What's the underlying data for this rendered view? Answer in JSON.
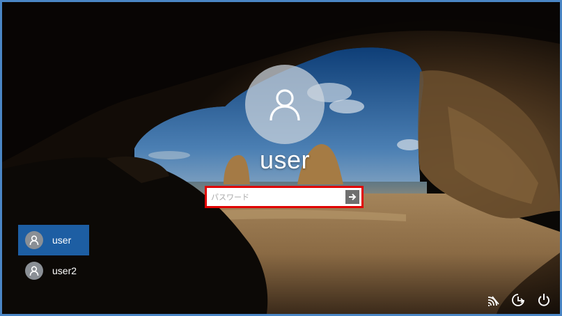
{
  "lock_screen": {
    "current_user": "user",
    "password_placeholder": "パスワード",
    "password_value": "",
    "submit_icon": "arrow-right-icon",
    "avatar_icon": "user-icon"
  },
  "user_switcher": {
    "items": [
      {
        "label": "user",
        "selected": true,
        "icon": "user-icon"
      },
      {
        "label": "user2",
        "selected": false,
        "icon": "user-icon"
      }
    ]
  },
  "system_tray": {
    "icons": [
      "network-icon",
      "ease-of-access-icon",
      "power-icon"
    ]
  },
  "colors": {
    "frame_border": "#4a86c5",
    "highlight_border": "#e00000",
    "selected_user_bg": "#1d5ea3",
    "submit_button_bg": "#6f6f6f"
  }
}
